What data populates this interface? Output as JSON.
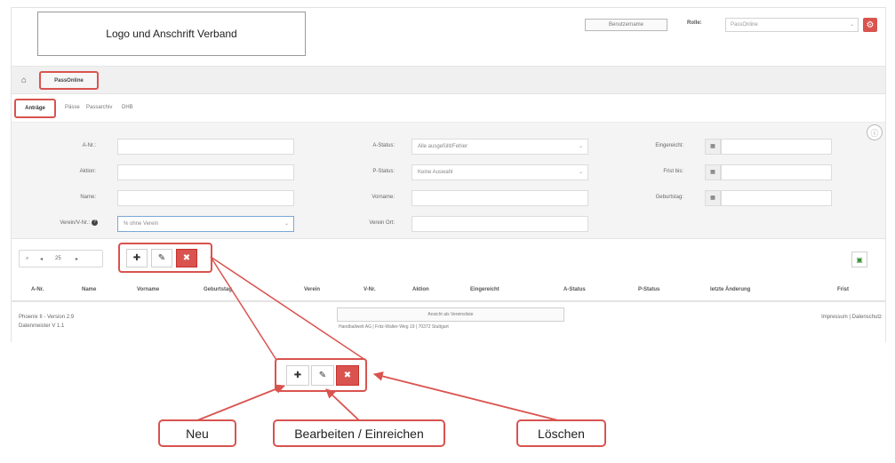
{
  "header": {
    "logo_text": "Logo und Anschrift Verband",
    "small_button": "Benutzername",
    "rolle_label": "Rolle:",
    "rolle_value": "PassOnline"
  },
  "nav": {
    "pass_online": "PassOnline"
  },
  "tabs": [
    "Anträge",
    "Pässe",
    "Passarchiv",
    "DHB"
  ],
  "filters": {
    "col1": [
      {
        "label": "A-Nr.:",
        "value": ""
      },
      {
        "label": "Aktion:",
        "value": ""
      },
      {
        "label": "Name:",
        "value": ""
      },
      {
        "label": "Verein/V-Nr.:",
        "value": "% ohne Verein"
      }
    ],
    "col2": [
      {
        "label": "A-Status:",
        "value": "Alle ausgefüllt/Fehler"
      },
      {
        "label": "P-Status:",
        "value": "Keine Auswahl"
      },
      {
        "label": "Vorname:",
        "value": ""
      },
      {
        "label": "Verein Ort:",
        "value": ""
      }
    ],
    "col3": [
      {
        "label": "Eingereicht:",
        "value": ""
      },
      {
        "label": "Frist bis:",
        "value": ""
      },
      {
        "label": "Geburtstag:",
        "value": ""
      }
    ]
  },
  "pager": {
    "page_size": "25"
  },
  "columns": [
    "A-Nr.",
    "Name",
    "Vorname",
    "Geburtstag",
    "Verein",
    "V-Nr.",
    "Aktion",
    "Eingereicht",
    "A-Status",
    "P-Status",
    "letzte Änderung",
    "Frist"
  ],
  "footer": {
    "version": "Phoenix II - Version 2.9",
    "datenmeister": "Datenmeister V 1.1",
    "center_box": "Ansicht als Vereinsliste",
    "center_text": "Handballwelt AG | Fritz-Walter-Weg 19 | 70372 Stuttgart",
    "right": "Impressum | Datenschutz"
  },
  "callouts": {
    "neu": "Neu",
    "bearbeiten": "Bearbeiten / Einreichen",
    "loeschen": "Löschen"
  },
  "icons": {
    "home": "home-icon",
    "gear": "gear-icon",
    "add": "plus-icon",
    "edit": "pencil-icon",
    "delete": "close-icon",
    "export": "excel-icon",
    "info": "info-icon"
  },
  "colors": {
    "accent": "#d9534f"
  }
}
